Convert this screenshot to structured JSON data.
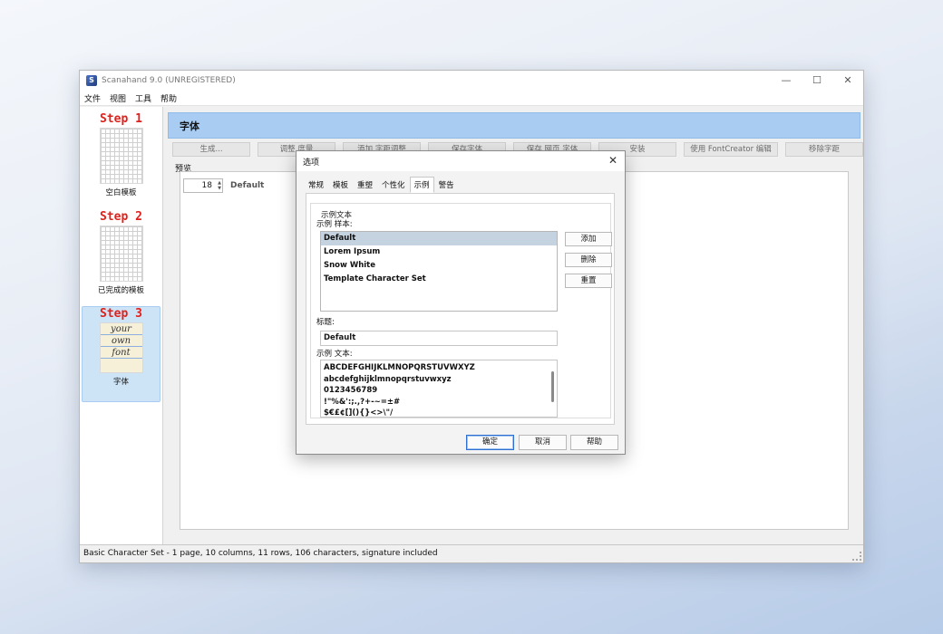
{
  "window": {
    "title": "Scanahand 9.0 (UNREGISTERED)",
    "controls": [
      "—",
      "☐",
      "✕"
    ]
  },
  "menu": [
    "文件",
    "视图",
    "工具",
    "帮助"
  ],
  "sidebar": {
    "steps": [
      {
        "label": "Step 1",
        "caption": "空白模板"
      },
      {
        "label": "Step 2",
        "caption": "已完成的模板"
      },
      {
        "label": "Step 3",
        "caption": "字体",
        "thumb_lines": [
          "your",
          "own",
          "font"
        ]
      }
    ]
  },
  "main": {
    "header": "字体",
    "toolbar": [
      "生成...",
      "调整 度量",
      "添加 字距调整",
      "保存字体",
      "保存 网页 字体",
      "安装",
      "使用 FontCreator 编辑",
      "移除字距"
    ],
    "preview_label": "预览",
    "font_size": "18",
    "sample_name": "Default"
  },
  "status": "Basic Character Set - 1 page, 10 columns, 11 rows, 106 characters, signature included",
  "dialog": {
    "title": "选项",
    "close": "✕",
    "tabs": [
      "常规",
      "模板",
      "重塑",
      "个性化",
      "示例",
      "警告"
    ],
    "active_tab": "示例",
    "group_title": "示例文本",
    "samples_label": "示例 样本:",
    "samples": [
      "Default",
      "Lorem Ipsum",
      "Snow White",
      "Template Character Set"
    ],
    "selected_sample": "Default",
    "add": "添加",
    "delete": "删除",
    "reset": "重置",
    "caption_label": "标题:",
    "caption_value": "Default",
    "sample_text_label": "示例 文本:",
    "sample_text_lines": [
      "ABCDEFGHIJKLMNOPQRSTUVWXYZ",
      "abcdefghijklmnopqrstuvwxyz",
      "0123456789",
      "!\"%&':;.,?+-~=±#",
      "$€£¢[](){}<>\\\"/"
    ],
    "ok": "确定",
    "cancel": "取消",
    "help": "帮助"
  }
}
